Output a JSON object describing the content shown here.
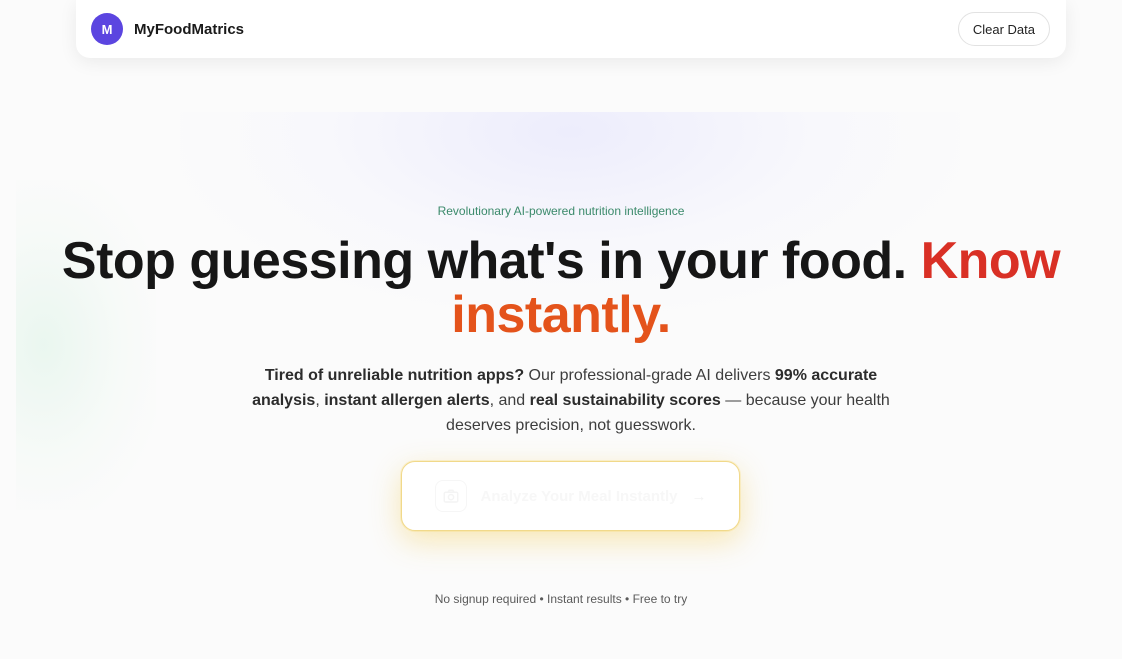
{
  "header": {
    "logo_letter": "M",
    "brand": "MyFoodMatrics",
    "clear_label": "Clear Data"
  },
  "hero": {
    "tagline": "Revolutionary AI-powered nutrition intelligence",
    "headline_main": "Stop guessing what's in your food. ",
    "headline_accent_1": "Know",
    "headline_accent_2": "instantly.",
    "sub": {
      "p1": "Tired of unreliable nutrition apps?",
      "p2": " Our professional-grade AI delivers ",
      "p3": "99% accurate analysis",
      "p4": ", ",
      "p5": "instant allergen alerts",
      "p6": ", and ",
      "p7": "real sustainability scores",
      "p8": " — because your health deserves precision, not guesswork."
    },
    "cta_label": "Analyze Your Meal Instantly",
    "cta_arrow": "→",
    "footnote": "No signup required • Instant results • Free to try"
  },
  "colors": {
    "logo_bg": "#5b45e0",
    "tagline": "#3b8a6b",
    "accent_know": "#d93025",
    "accent_instant": "#e4531b",
    "cta_border": "#f1d98a"
  },
  "icons": {
    "cta_icon": "camera-icon"
  }
}
